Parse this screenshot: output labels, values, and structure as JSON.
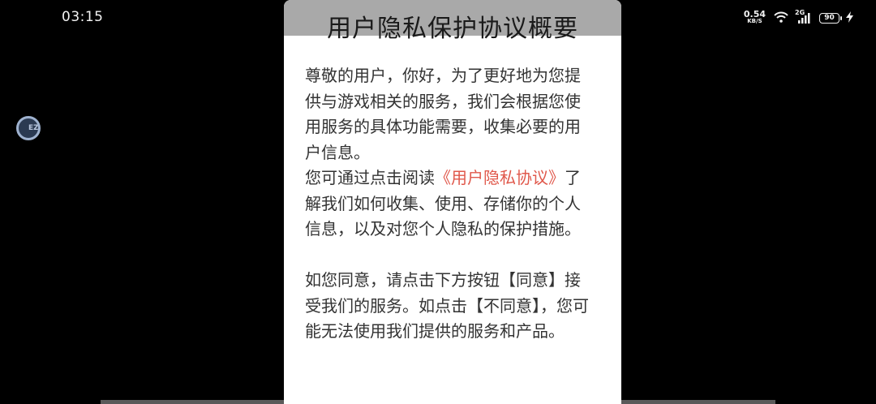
{
  "status_bar": {
    "time": "03:15",
    "net_speed_value": "0.54",
    "net_speed_unit": "KB/S",
    "network_generation": "2G",
    "battery_level": "90",
    "icons": [
      "wifi-icon",
      "cellular-signal-icon",
      "battery-icon",
      "charging-bolt-icon"
    ]
  },
  "floating_bubble": {
    "text": "EZ"
  },
  "dialog": {
    "title": "用户隐私保护协议概要",
    "para1": "尊敬的用户，你好，为了更好地为您提供与游戏相关的服务，我们会根据您使用服务的具体功能需要，收集必要的用户信息。",
    "para2_before": "您可通过点击阅读",
    "privacy_link": "《用户隐私协议》",
    "para2_after": "了解我们如何收集、使用、存储你的个人信息，以及对您个人隐私的保护措施。",
    "para3": "如您同意，请点击下方按钮【同意】接受我们的服务。如点击【不同意】，您可能无法使用我们提供的服务和产品。"
  },
  "colors": {
    "background": "#000000",
    "header_gray": "#a9a9a9",
    "link_red": "#e0584b",
    "body_text": "#333333"
  }
}
